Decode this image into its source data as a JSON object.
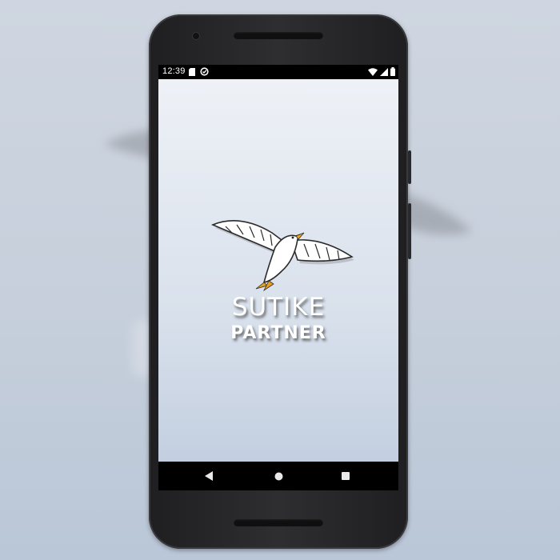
{
  "status_bar": {
    "time": "12:39",
    "left_icons": [
      "sd-card-icon",
      "sync-icon"
    ],
    "right_icons": [
      "wifi-icon",
      "cell-signal-icon",
      "battery-icon"
    ]
  },
  "app": {
    "logo_icon": "seagull-logo-icon",
    "title": "SUTIKE",
    "subtitle": "PARTNER"
  },
  "nav_bar": {
    "buttons": [
      "back-icon",
      "home-icon",
      "recents-icon"
    ]
  },
  "colors": {
    "background": "#c8d1dd",
    "phone_body": "#2a2a2d",
    "screen_top": "#eef1f6",
    "screen_bottom": "#c3cfe0",
    "brand_text": "#ffffff"
  }
}
